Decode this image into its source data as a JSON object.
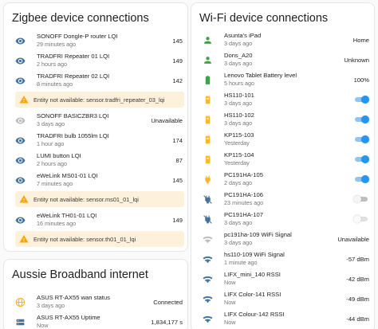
{
  "zigbee": {
    "title": "Zigbee device connections",
    "rows": [
      {
        "name": "SONOFF Dongle-P router LQI",
        "secondary": "29 minutes ago",
        "value": "145"
      },
      {
        "name": "TRADFRI Repeater 01 LQI",
        "secondary": "2 hours ago",
        "value": "149"
      },
      {
        "name": "TRADFRI Repeater 02 LQI",
        "secondary": "8 minutes ago",
        "value": "142"
      },
      {
        "warning": "Entity not available: sensor.tradfri_repeater_03_lqi"
      },
      {
        "name": "SONOFF BASICZBR3 LQI",
        "secondary": "3 days ago",
        "value": "Unavailable"
      },
      {
        "name": "TRADFRI bulb 1055lm LQI",
        "secondary": "1 hour ago",
        "value": "174"
      },
      {
        "name": "LUMI button LQI",
        "secondary": "2 hours ago",
        "value": "87"
      },
      {
        "name": "eWeLink MS01-01 LQI",
        "secondary": "7 minutes ago",
        "value": "145"
      },
      {
        "warning": "Entity not available: sensor.ms01_01_lqi"
      },
      {
        "name": "eWeLink TH01-01 LQI",
        "secondary": "16 minutes ago",
        "value": "149"
      },
      {
        "warning": "Entity not available: sensor.th01_01_lqi"
      }
    ]
  },
  "aussie": {
    "title": "Aussie Broadband internet",
    "rows": [
      {
        "name": "ASUS RT-AX55 wan status",
        "secondary": "3 days ago",
        "value": "Connected"
      },
      {
        "name": "ASUS RT-AX55 Uptime",
        "secondary": "Now",
        "value": "1,834,177 s"
      }
    ]
  },
  "wifi": {
    "title": "Wi-Fi device connections",
    "rows": [
      {
        "name": "Asunta's iPad",
        "secondary": "3 days ago",
        "value": "Home"
      },
      {
        "name": "Dons_A20",
        "secondary": "3 days ago",
        "value": "Unknown"
      },
      {
        "name": "Lenovo Tablet Battery level",
        "secondary": "5 hours ago",
        "value": "100%"
      },
      {
        "name": "HS110-101",
        "secondary": "3 days ago",
        "toggle": "on"
      },
      {
        "name": "HS110-102",
        "secondary": "3 days ago",
        "toggle": "on"
      },
      {
        "name": "KP115-103",
        "secondary": "Yesterday",
        "toggle": "on"
      },
      {
        "name": "KP115-104",
        "secondary": "Yesterday",
        "toggle": "on"
      },
      {
        "name": "PC191HA-105",
        "secondary": "2 days ago",
        "toggle": "on"
      },
      {
        "name": "PC191HA-106",
        "secondary": "23 minutes ago",
        "toggle": "off"
      },
      {
        "name": "PC191HA-107",
        "secondary": "3 days ago",
        "toggle": "disabled"
      },
      {
        "name": "pc191ha-109 WiFi Signal",
        "secondary": "3 days ago",
        "value": "Unavailable"
      },
      {
        "name": "hs110-109 WiFi Signal",
        "secondary": "1 minute ago",
        "value": "-57 dBm"
      },
      {
        "name": "LIFX_mini_140 RSSI",
        "secondary": "Now",
        "value": "-42 dBm"
      },
      {
        "name": "LIFX Color-141 RSSI",
        "secondary": "Now",
        "value": "-49 dBm"
      },
      {
        "name": "LIFX Colour-142 RSSI",
        "secondary": "Now",
        "value": "-44 dBm"
      }
    ]
  },
  "icons": {
    "zigbee": [
      "eye-icon",
      "eye-icon",
      "eye-icon",
      "warning-icon",
      "eye-off-icon",
      "eye-icon",
      "eye-icon",
      "eye-icon",
      "warning-icon",
      "eye-icon",
      "warning-icon"
    ],
    "aussie": [
      "globe-icon",
      "router-icon"
    ],
    "wifi": [
      "person-icon",
      "person-icon",
      "battery-icon",
      "plug-icon",
      "plug-icon",
      "plug-icon",
      "plug-icon",
      "power-plug-icon",
      "power-plug-off-icon",
      "power-plug-off-icon",
      "wifi-off-icon",
      "wifi-icon",
      "wifi-icon",
      "wifi-icon",
      "wifi-icon"
    ]
  },
  "colors": {
    "accent": "#2196f3",
    "icon": "#44739e",
    "warning": "#ffa600",
    "success": "#43a047",
    "amber": "#fdb728",
    "muted": "#9e9e9e"
  }
}
